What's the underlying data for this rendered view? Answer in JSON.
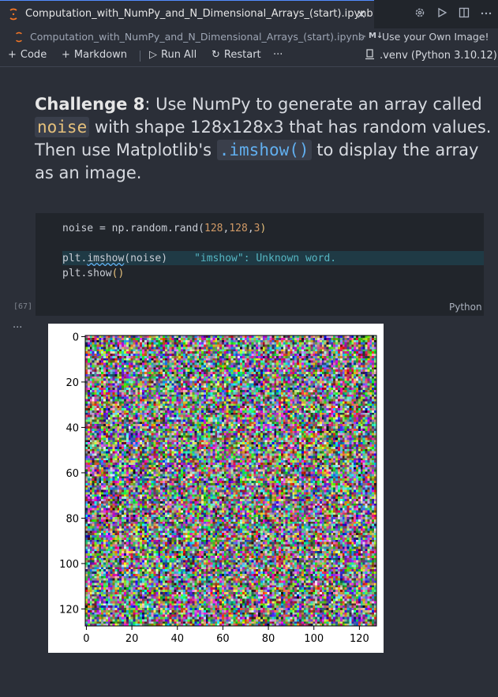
{
  "tab": {
    "title": "Computation_with_NumPy_and_N_Dimensional_Arrays_(start).ipynb",
    "close": "×"
  },
  "tab_actions": {
    "settings_icon": "gear-icon",
    "run_icon": "play-icon",
    "split_icon": "split-editor-icon",
    "more_icon": "ellipsis-icon"
  },
  "breadcrumb": {
    "file": "Computation_with_NumPy_and_N_Dimensional_Arrays_(start).ipynb",
    "separator": ">",
    "md_badge": "M↓",
    "section": "Use your Own Image!"
  },
  "toolbar": {
    "code_label": "Code",
    "markdown_label": "Markdown",
    "run_all_label": "Run All",
    "restart_label": "Restart",
    "more": "···",
    "kernel_label": ".venv (Python 3.10.12)"
  },
  "markdown": {
    "bold": "Challenge 8",
    "t1": ": Use NumPy to generate an array called ",
    "code1": "noise",
    "t2": " with shape 128x128x3 that has random values. Then use Matplotlib's ",
    "code2": ".imshow()",
    "t3": " to display the array as an image."
  },
  "code": {
    "l1_a": "noise = np.random.rand(",
    "l1_b": "128",
    "l1_c": ",",
    "l1_d": "128",
    "l1_e": ",",
    "l1_f": "3",
    "l1_g": ")",
    "l2_a": "plt.",
    "l2_b": "imshow",
    "l2_c": "(noise)",
    "l2_diag": "\"imshow\": Unknown word.",
    "l3_a": "plt.show",
    "l3_b": "()"
  },
  "cell": {
    "exec_count": "[67]",
    "language": "Python",
    "output_menu": "···"
  },
  "chart_data": {
    "type": "heatmap",
    "title": "",
    "xlabel": "",
    "ylabel": "",
    "x_ticks": [
      "0",
      "20",
      "40",
      "60",
      "80",
      "100",
      "120"
    ],
    "y_ticks": [
      "0",
      "20",
      "40",
      "60",
      "80",
      "100",
      "120"
    ],
    "xlim": [
      -0.5,
      127.5
    ],
    "ylim": [
      127.5,
      -0.5
    ],
    "content": "random RGB noise, shape 128x128x3"
  }
}
